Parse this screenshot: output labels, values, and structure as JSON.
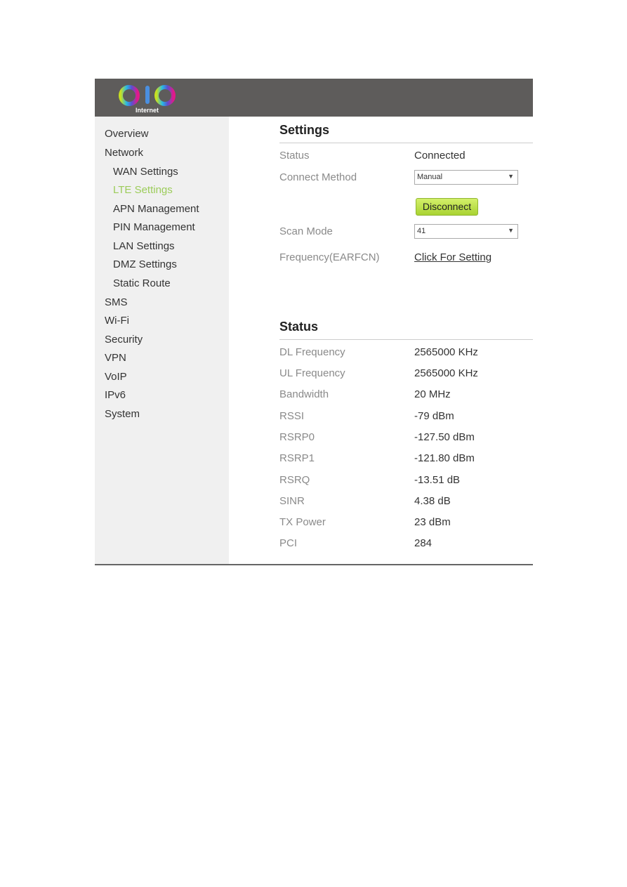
{
  "brand": {
    "logo_text": "OLO",
    "logo_subtitle": "Internet"
  },
  "sidebar": {
    "items": [
      {
        "label": "Overview",
        "sub": false,
        "active": false
      },
      {
        "label": "Network",
        "sub": false,
        "active": false
      },
      {
        "label": "WAN Settings",
        "sub": true,
        "active": false
      },
      {
        "label": "LTE Settings",
        "sub": true,
        "active": true
      },
      {
        "label": "APN Management",
        "sub": true,
        "active": false
      },
      {
        "label": "PIN Management",
        "sub": true,
        "active": false
      },
      {
        "label": "LAN Settings",
        "sub": true,
        "active": false
      },
      {
        "label": "DMZ Settings",
        "sub": true,
        "active": false
      },
      {
        "label": "Static Route",
        "sub": true,
        "active": false
      },
      {
        "label": "SMS",
        "sub": false,
        "active": false
      },
      {
        "label": "Wi-Fi",
        "sub": false,
        "active": false
      },
      {
        "label": "Security",
        "sub": false,
        "active": false
      },
      {
        "label": "VPN",
        "sub": false,
        "active": false
      },
      {
        "label": "VoIP",
        "sub": false,
        "active": false
      },
      {
        "label": "IPv6",
        "sub": false,
        "active": false
      },
      {
        "label": "System",
        "sub": false,
        "active": false
      }
    ]
  },
  "settings": {
    "title": "Settings",
    "status_label": "Status",
    "status_value": "Connected",
    "connect_method_label": "Connect Method",
    "connect_method_value": "Manual",
    "disconnect_label": "Disconnect",
    "scan_mode_label": "Scan Mode",
    "scan_mode_value": "41",
    "frequency_label": "Frequency(EARFCN)",
    "frequency_link": "Click For Setting"
  },
  "status": {
    "title": "Status",
    "rows": [
      {
        "label": "DL Frequency",
        "value": "2565000 KHz"
      },
      {
        "label": "UL Frequency",
        "value": "2565000 KHz"
      },
      {
        "label": "Bandwidth",
        "value": "20 MHz"
      },
      {
        "label": "RSSI",
        "value": "-79 dBm"
      },
      {
        "label": "RSRP0",
        "value": "-127.50 dBm"
      },
      {
        "label": "RSRP1",
        "value": "-121.80 dBm"
      },
      {
        "label": "RSRQ",
        "value": "-13.51 dB"
      },
      {
        "label": "SINR",
        "value": "4.38 dB"
      },
      {
        "label": "TX Power",
        "value": "23 dBm"
      },
      {
        "label": "PCI",
        "value": "284"
      }
    ]
  },
  "colors": {
    "header_bg": "#5e5c5b",
    "sidebar_bg": "#f0f0f0",
    "active_nav": "#9ccc5a",
    "button_green": "#b5dc3c"
  }
}
